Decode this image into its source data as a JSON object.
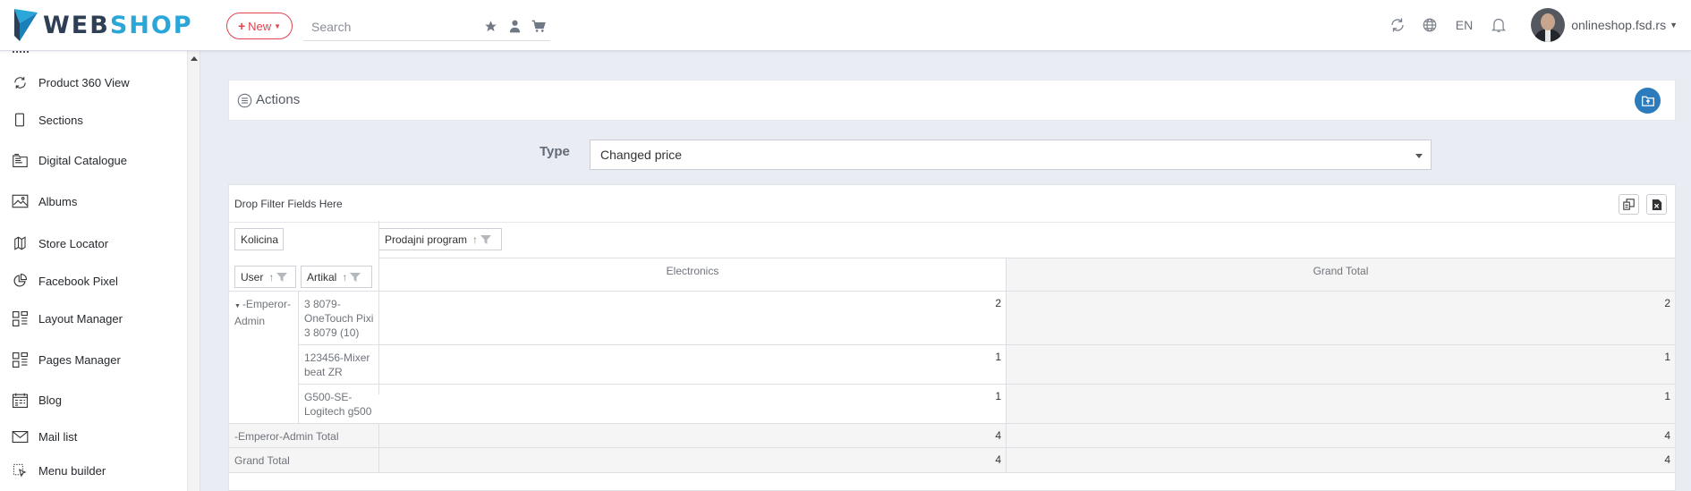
{
  "header": {
    "logo_part1": "WEB",
    "logo_part2": "SHOP",
    "new_label": "New",
    "search_placeholder": "Search",
    "language": "EN",
    "account": "onlineshop.fsd.rs"
  },
  "sidebar": {
    "items": [
      {
        "label": "Product 360 View",
        "icon": "rotate-icon"
      },
      {
        "label": "Sections",
        "icon": "tablet-icon"
      },
      {
        "label": "Digital Catalogue",
        "icon": "book-icon"
      },
      {
        "label": "Albums",
        "icon": "image-icon"
      },
      {
        "label": "Store Locator",
        "icon": "map-pin-icon"
      },
      {
        "label": "Facebook Pixel",
        "icon": "pie-chart-icon"
      },
      {
        "label": "Layout Manager",
        "icon": "layout-icon"
      },
      {
        "label": "Pages Manager",
        "icon": "pages-icon"
      },
      {
        "label": "Blog",
        "icon": "blog-icon"
      },
      {
        "label": "Mail list",
        "icon": "mail-icon"
      },
      {
        "label": "Menu builder",
        "icon": "menu-builder-icon"
      }
    ]
  },
  "actions": {
    "title": "Actions"
  },
  "filter": {
    "type_label": "Type",
    "type_value": "Changed price"
  },
  "pivot": {
    "drop_filter_text": "Drop Filter Fields Here",
    "data_field": "Kolicina",
    "column_field": "Prodajni program",
    "row_fields": [
      "User",
      "Artikal"
    ],
    "col_headers": [
      "Electronics",
      "Grand Total"
    ],
    "group_label": "-Emperor-Admin",
    "rows": [
      {
        "artikal": "3 8079-OneTouch Pixi 3 8079 (10)",
        "electronics": "2",
        "total": "2"
      },
      {
        "artikal": "123456-Mixer beat ZR",
        "electronics": "1",
        "total": "1"
      },
      {
        "artikal": "G500-SE-Logitech g500",
        "electronics": "1",
        "total": "1"
      }
    ],
    "group_total": {
      "label": "-Emperor-Admin Total",
      "electronics": "4",
      "total": "4"
    },
    "grand_total": {
      "label": "Grand Total",
      "electronics": "4",
      "total": "4"
    }
  }
}
